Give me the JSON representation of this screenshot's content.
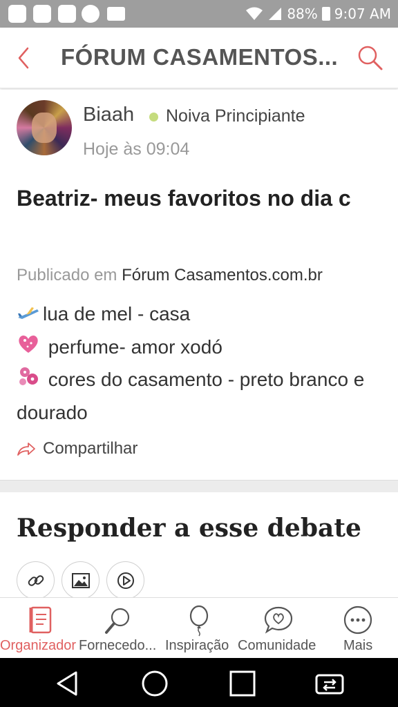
{
  "status_bar": {
    "battery": "88%",
    "time": "9:07 AM",
    "icons": [
      "app-icon",
      "app-icon",
      "photos-icon",
      "circle-icon",
      "message-icon",
      "wifi-icon",
      "signal-icon",
      "battery-icon"
    ]
  },
  "app_bar": {
    "title": "FÓRUM CASAMENTOS...",
    "back_icon": "chevron-left-icon",
    "search_icon": "search-icon"
  },
  "post": {
    "author": "Biaah",
    "level": "Noiva Principiante",
    "time": "Hoje às 09:04",
    "title": "Beatriz- meus favoritos no dia c",
    "published_prefix": "Publicado em",
    "forum": "Fórum Casamentos.com.br",
    "body": [
      {
        "emoji": "airplane-icon",
        "text": "lua de mel - casa"
      },
      {
        "emoji": "sparkling-heart-icon",
        "text": "perfume- amor xodó"
      },
      {
        "emoji": "blossom-icon",
        "text": "cores do casamento - preto branco e dourado"
      }
    ],
    "share_label": "Compartilhar"
  },
  "reply": {
    "title": "Responder a esse debate",
    "tools": [
      "link-icon",
      "image-icon",
      "play-icon"
    ]
  },
  "tabs": [
    {
      "label": "Organizador",
      "icon": "planner-icon",
      "active": true
    },
    {
      "label": "Fornecedo...",
      "icon": "magnifier-icon",
      "active": false
    },
    {
      "label": "Inspiração",
      "icon": "balloon-icon",
      "active": false
    },
    {
      "label": "Comunidade",
      "icon": "chat-heart-icon",
      "active": false
    },
    {
      "label": "Mais",
      "icon": "more-icon",
      "active": false
    }
  ],
  "colors": {
    "accent": "#e06060",
    "status_bar": "#9e9e9e",
    "level_dot": "#c5dc7e",
    "text_muted": "#999999"
  }
}
